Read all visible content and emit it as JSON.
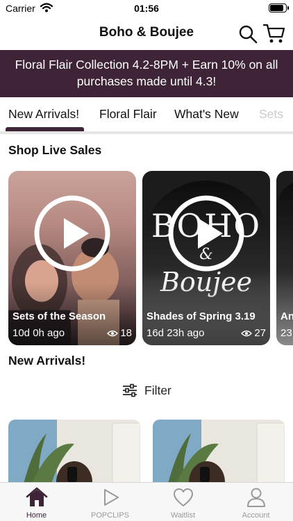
{
  "status_bar": {
    "carrier": "Carrier",
    "time": "01:56",
    "battery_level": 0.9
  },
  "header": {
    "title": "Boho & Boujee",
    "search_icon": "search-icon",
    "cart_icon": "cart-icon"
  },
  "promo": {
    "text": "Floral Flair Collection 4.2-8PM + Earn 10% on all purchases made until 4.3!"
  },
  "tabs": [
    {
      "label": "New Arrivals!",
      "active": true
    },
    {
      "label": "Floral Flair",
      "active": false
    },
    {
      "label": "What's New",
      "active": false
    },
    {
      "label": "Sets",
      "active": false
    }
  ],
  "live_sales": {
    "title": "Shop Live Sales",
    "cards": [
      {
        "title": "Sets of the Season",
        "time": "10d 0h ago",
        "views": "18"
      },
      {
        "title": "Shades of Spring 3.19",
        "time": "16d 23h ago",
        "views": "27",
        "brand_top": "BOHO",
        "brand_amp": "&",
        "brand_script": "Boujee"
      },
      {
        "title": "An",
        "time": "23"
      }
    ]
  },
  "new_arrivals": {
    "title": "New Arrivals!",
    "filter_label": "Filter"
  },
  "bottom_nav": [
    {
      "label": "Home",
      "icon": "home-icon",
      "active": true
    },
    {
      "label": "POPCLIPS",
      "icon": "play-icon",
      "active": false
    },
    {
      "label": "Waitlist",
      "icon": "heart-icon",
      "active": false
    },
    {
      "label": "Account",
      "icon": "person-icon",
      "active": false
    }
  ],
  "colors": {
    "brand": "#3e2436",
    "inactive": "#9a9a9a"
  }
}
